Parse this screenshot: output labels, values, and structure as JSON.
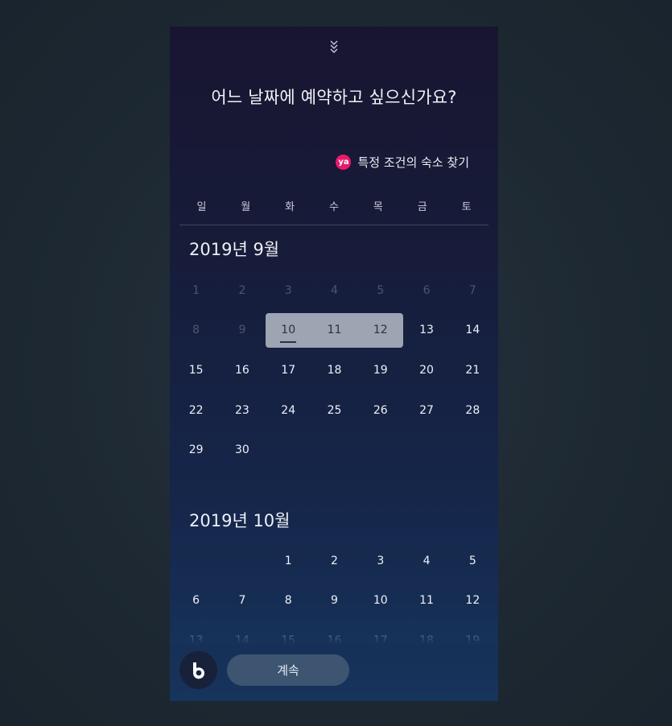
{
  "header": {
    "collapse_icon": "double-chevron-down-icon",
    "title": "어느 날짜에 예약하고 싶으신가요?"
  },
  "partner": {
    "icon_text": "ya",
    "icon_color": "#e8196b",
    "label": "특정 조건의 숙소 찾기"
  },
  "weekdays": [
    "일",
    "월",
    "화",
    "수",
    "목",
    "금",
    "토"
  ],
  "months": [
    {
      "title": "2019년 9월",
      "days": [
        {
          "d": "1",
          "past": true
        },
        {
          "d": "2",
          "past": true
        },
        {
          "d": "3",
          "past": true
        },
        {
          "d": "4",
          "past": true
        },
        {
          "d": "5",
          "past": true
        },
        {
          "d": "6",
          "past": true
        },
        {
          "d": "7",
          "past": true
        },
        {
          "d": "8",
          "past": true
        },
        {
          "d": "9",
          "past": true
        },
        {
          "d": "10",
          "selected": true,
          "today": true,
          "start": true
        },
        {
          "d": "11",
          "selected": true
        },
        {
          "d": "12",
          "selected": true,
          "end": true
        },
        {
          "d": "13"
        },
        {
          "d": "14"
        },
        {
          "d": "15"
        },
        {
          "d": "16"
        },
        {
          "d": "17"
        },
        {
          "d": "18"
        },
        {
          "d": "19"
        },
        {
          "d": "20"
        },
        {
          "d": "21"
        },
        {
          "d": "22"
        },
        {
          "d": "23"
        },
        {
          "d": "24"
        },
        {
          "d": "25"
        },
        {
          "d": "26"
        },
        {
          "d": "27"
        },
        {
          "d": "28"
        },
        {
          "d": "29"
        },
        {
          "d": "30"
        }
      ]
    },
    {
      "title": "2019년 10월",
      "days": [
        {
          "d": ""
        },
        {
          "d": ""
        },
        {
          "d": "1"
        },
        {
          "d": "2"
        },
        {
          "d": "3"
        },
        {
          "d": "4"
        },
        {
          "d": "5"
        },
        {
          "d": "6"
        },
        {
          "d": "7"
        },
        {
          "d": "8"
        },
        {
          "d": "9"
        },
        {
          "d": "10"
        },
        {
          "d": "11"
        },
        {
          "d": "12"
        },
        {
          "d": "13"
        },
        {
          "d": "14"
        },
        {
          "d": "15"
        },
        {
          "d": "16"
        },
        {
          "d": "17"
        },
        {
          "d": "18"
        },
        {
          "d": "19"
        }
      ]
    }
  ],
  "footer": {
    "assistant_icon": "bixby-icon",
    "continue_label": "계속"
  }
}
